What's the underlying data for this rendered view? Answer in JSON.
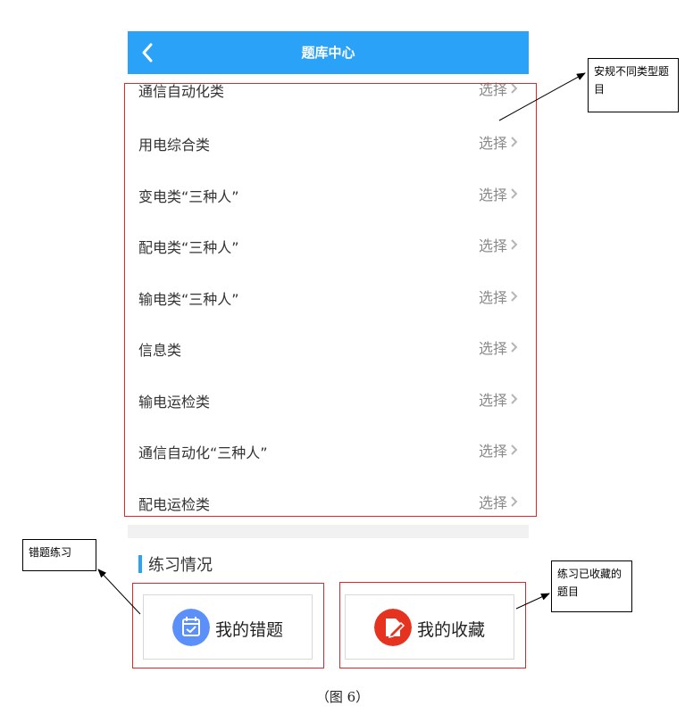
{
  "header": {
    "title": "题库中心"
  },
  "list": {
    "action_label": "选择",
    "items": [
      {
        "label": "通信自动化类"
      },
      {
        "label": "用电综合类"
      },
      {
        "label": "变电类“三种人”"
      },
      {
        "label": "配电类“三种人”"
      },
      {
        "label": "输电类“三种人”"
      },
      {
        "label": "信息类"
      },
      {
        "label": "输电运检类"
      },
      {
        "label": "通信自动化“三种人”"
      },
      {
        "label": "配电运检类"
      }
    ]
  },
  "practice": {
    "section_title": "练习情况",
    "wrong_label": "我的错题",
    "favorites_label": "我的收藏"
  },
  "annotations": {
    "types_note": "安规不同类型题目",
    "wrong_note": "错题练习",
    "favorites_note": "练习已收藏的题目"
  },
  "caption": "（图 6）",
  "colors": {
    "header": "#2aa2f8",
    "highlight_box": "#e0272c",
    "wrong_icon": "#5b8ff9",
    "favorites_icon": "#e5331f"
  },
  "icons": {
    "back": "chevron-left-icon",
    "row": "chevron-right-icon",
    "wrong": "calendar-check-icon",
    "favorites": "pen-note-icon"
  }
}
